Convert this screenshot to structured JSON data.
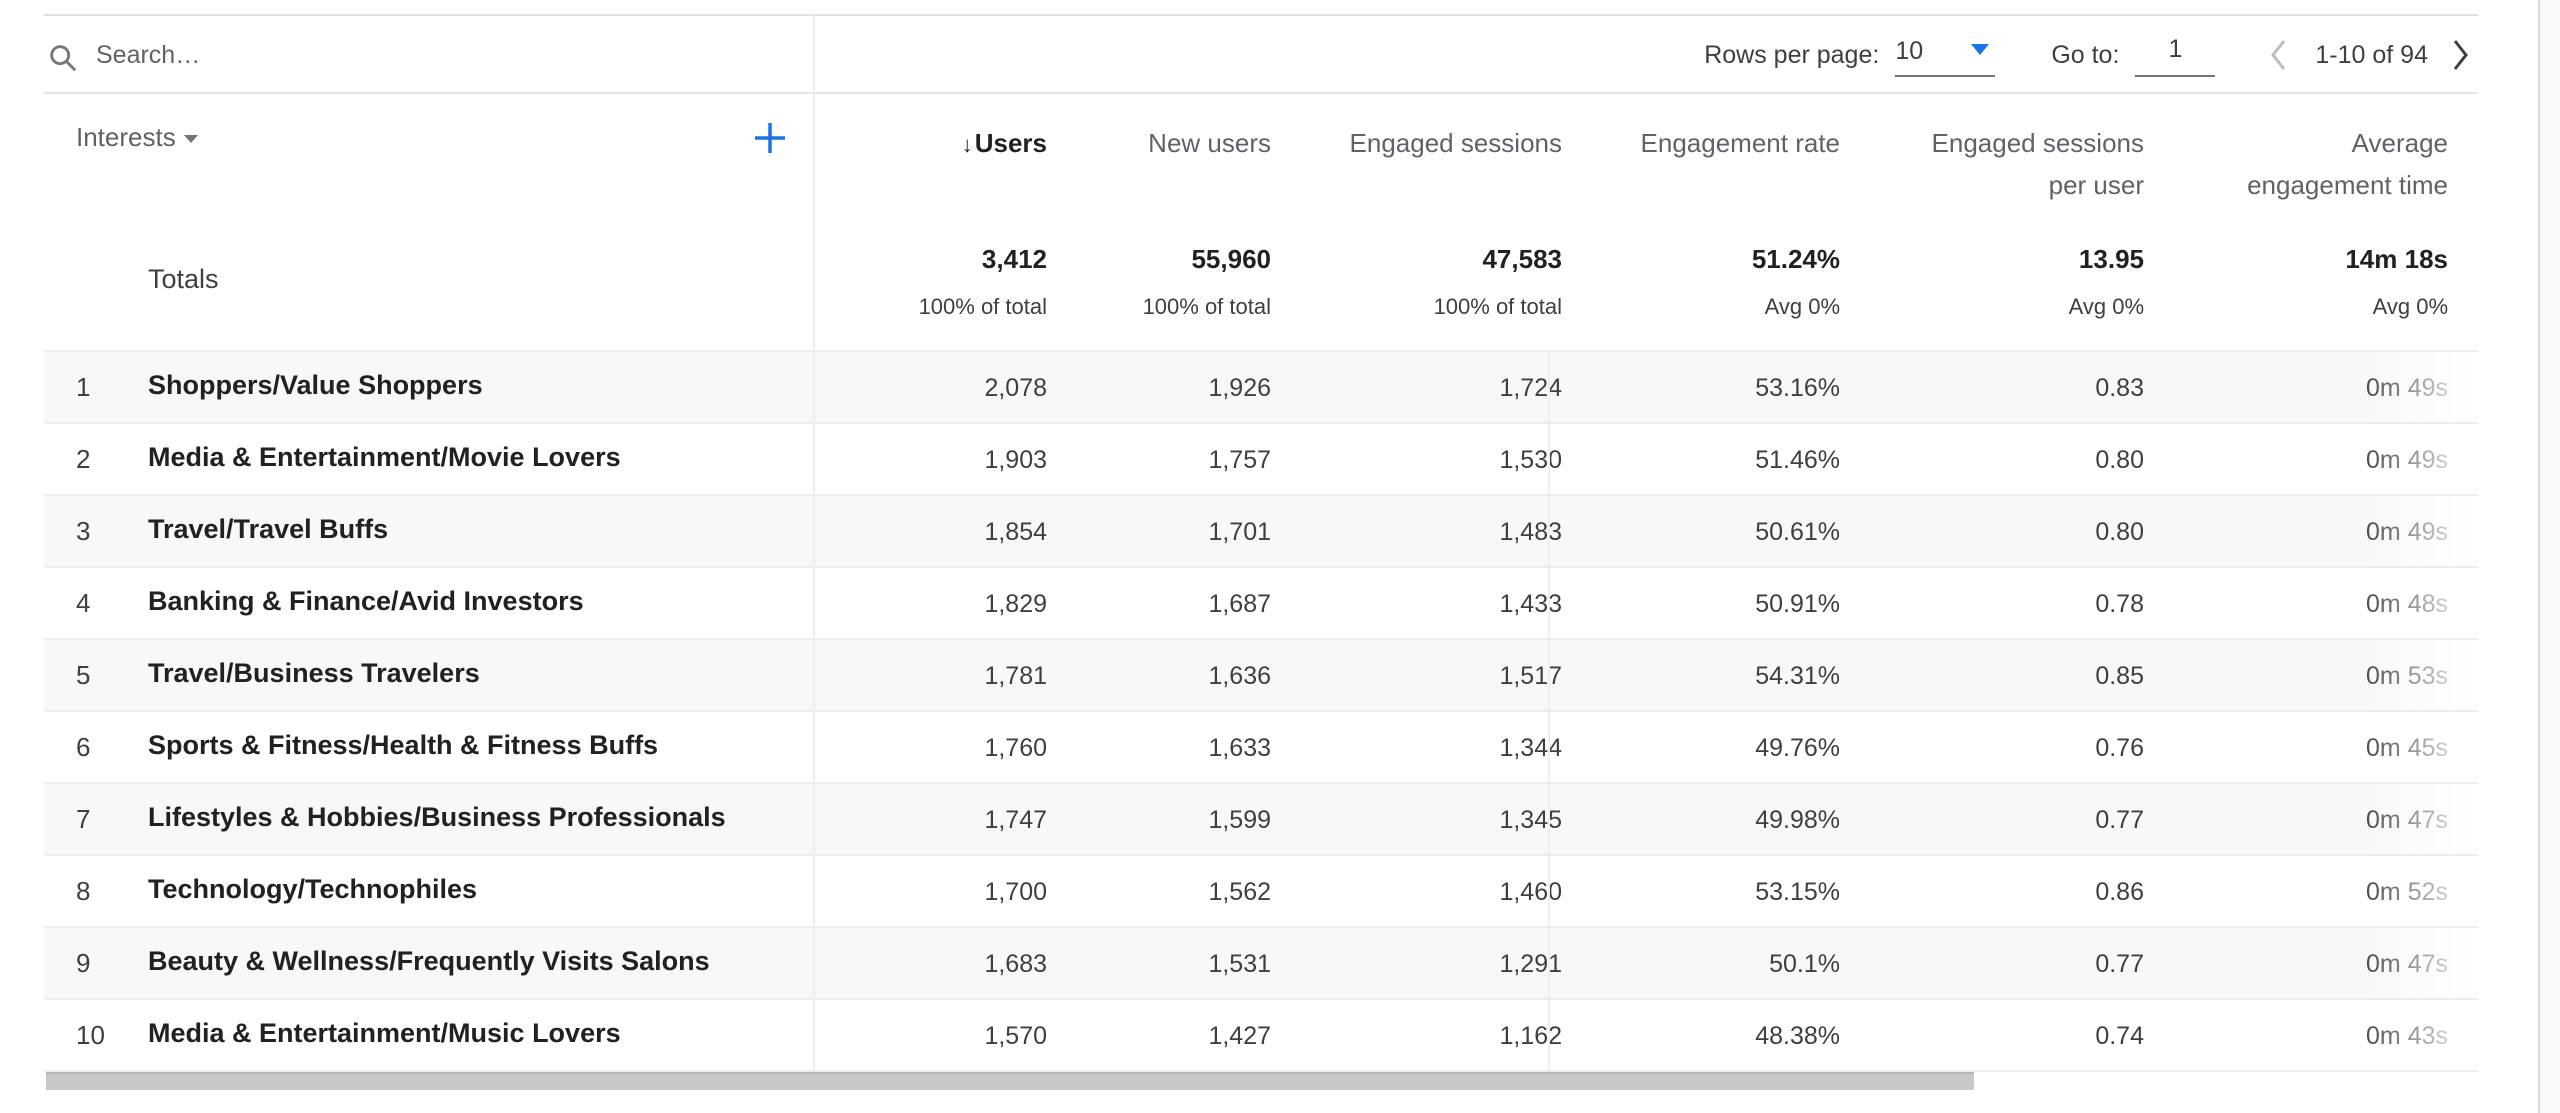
{
  "search": {
    "placeholder": "Search…",
    "value": ""
  },
  "pagination": {
    "rows_per_page_label": "Rows per page:",
    "rows_per_page_value": "10",
    "goto_label": "Go to:",
    "goto_value": "1",
    "range_text": "1-10 of 94"
  },
  "dimension": {
    "label": "Interests"
  },
  "columns": [
    {
      "key": "users",
      "label": "Users",
      "sorted": "desc",
      "sort_indicator": "↓"
    },
    {
      "key": "new_users",
      "label": "New users"
    },
    {
      "key": "engaged_sessions",
      "label": "Engaged sessions"
    },
    {
      "key": "engagement_rate",
      "label": "Engagement rate"
    },
    {
      "key": "engaged_sessions_per_user",
      "label_line1": "Engaged sessions",
      "label_line2": "per user"
    },
    {
      "key": "avg_engagement_time",
      "label_line1": "Average",
      "label_line2": "engagement time"
    }
  ],
  "totals": {
    "label": "Totals",
    "users": {
      "value": "3,412",
      "sub": "100% of total"
    },
    "new_users": {
      "value": "55,960",
      "sub": "100% of total"
    },
    "engaged_sessions": {
      "value": "47,583",
      "sub": "100% of total"
    },
    "engagement_rate": {
      "value": "51.24%",
      "sub": "Avg 0%"
    },
    "engaged_sessions_per_user": {
      "value": "13.95",
      "sub": "Avg 0%"
    },
    "avg_engagement_time": {
      "value": "14m 18s",
      "sub": "Avg 0%"
    }
  },
  "rows": [
    {
      "num": "1",
      "name": "Shoppers/Value Shoppers",
      "users": "2,078",
      "new_users": "1,926",
      "engaged_sessions": "1,724",
      "engagement_rate": "53.16%",
      "engaged_sessions_per_user": "0.83",
      "avg_engagement_time": "0m 49s"
    },
    {
      "num": "2",
      "name": "Media & Entertainment/Movie Lovers",
      "users": "1,903",
      "new_users": "1,757",
      "engaged_sessions": "1,530",
      "engagement_rate": "51.46%",
      "engaged_sessions_per_user": "0.80",
      "avg_engagement_time": "0m 49s"
    },
    {
      "num": "3",
      "name": "Travel/Travel Buffs",
      "users": "1,854",
      "new_users": "1,701",
      "engaged_sessions": "1,483",
      "engagement_rate": "50.61%",
      "engaged_sessions_per_user": "0.80",
      "avg_engagement_time": "0m 49s"
    },
    {
      "num": "4",
      "name": "Banking & Finance/Avid Investors",
      "users": "1,829",
      "new_users": "1,687",
      "engaged_sessions": "1,433",
      "engagement_rate": "50.91%",
      "engaged_sessions_per_user": "0.78",
      "avg_engagement_time": "0m 48s"
    },
    {
      "num": "5",
      "name": "Travel/Business Travelers",
      "users": "1,781",
      "new_users": "1,636",
      "engaged_sessions": "1,517",
      "engagement_rate": "54.31%",
      "engaged_sessions_per_user": "0.85",
      "avg_engagement_time": "0m 53s"
    },
    {
      "num": "6",
      "name": "Sports & Fitness/Health & Fitness Buffs",
      "users": "1,760",
      "new_users": "1,633",
      "engaged_sessions": "1,344",
      "engagement_rate": "49.76%",
      "engaged_sessions_per_user": "0.76",
      "avg_engagement_time": "0m 45s"
    },
    {
      "num": "7",
      "name": "Lifestyles & Hobbies/Business Professionals",
      "users": "1,747",
      "new_users": "1,599",
      "engaged_sessions": "1,345",
      "engagement_rate": "49.98%",
      "engaged_sessions_per_user": "0.77",
      "avg_engagement_time": "0m 47s"
    },
    {
      "num": "8",
      "name": "Technology/Technophiles",
      "users": "1,700",
      "new_users": "1,562",
      "engaged_sessions": "1,460",
      "engagement_rate": "53.15%",
      "engaged_sessions_per_user": "0.86",
      "avg_engagement_time": "0m 52s"
    },
    {
      "num": "9",
      "name": "Beauty & Wellness/Frequently Visits Salons",
      "users": "1,683",
      "new_users": "1,531",
      "engaged_sessions": "1,291",
      "engagement_rate": "50.1%",
      "engaged_sessions_per_user": "0.77",
      "avg_engagement_time": "0m 47s"
    },
    {
      "num": "10",
      "name": "Media & Entertainment/Music Lovers",
      "users": "1,570",
      "new_users": "1,427",
      "engaged_sessions": "1,162",
      "engagement_rate": "48.38%",
      "engaged_sessions_per_user": "0.74",
      "avg_engagement_time": "0m 43s"
    }
  ],
  "colors": {
    "accent": "#1a73e8",
    "row_alt": "#f8f8fa",
    "text": "#3c4043",
    "muted": "#5f6368"
  }
}
